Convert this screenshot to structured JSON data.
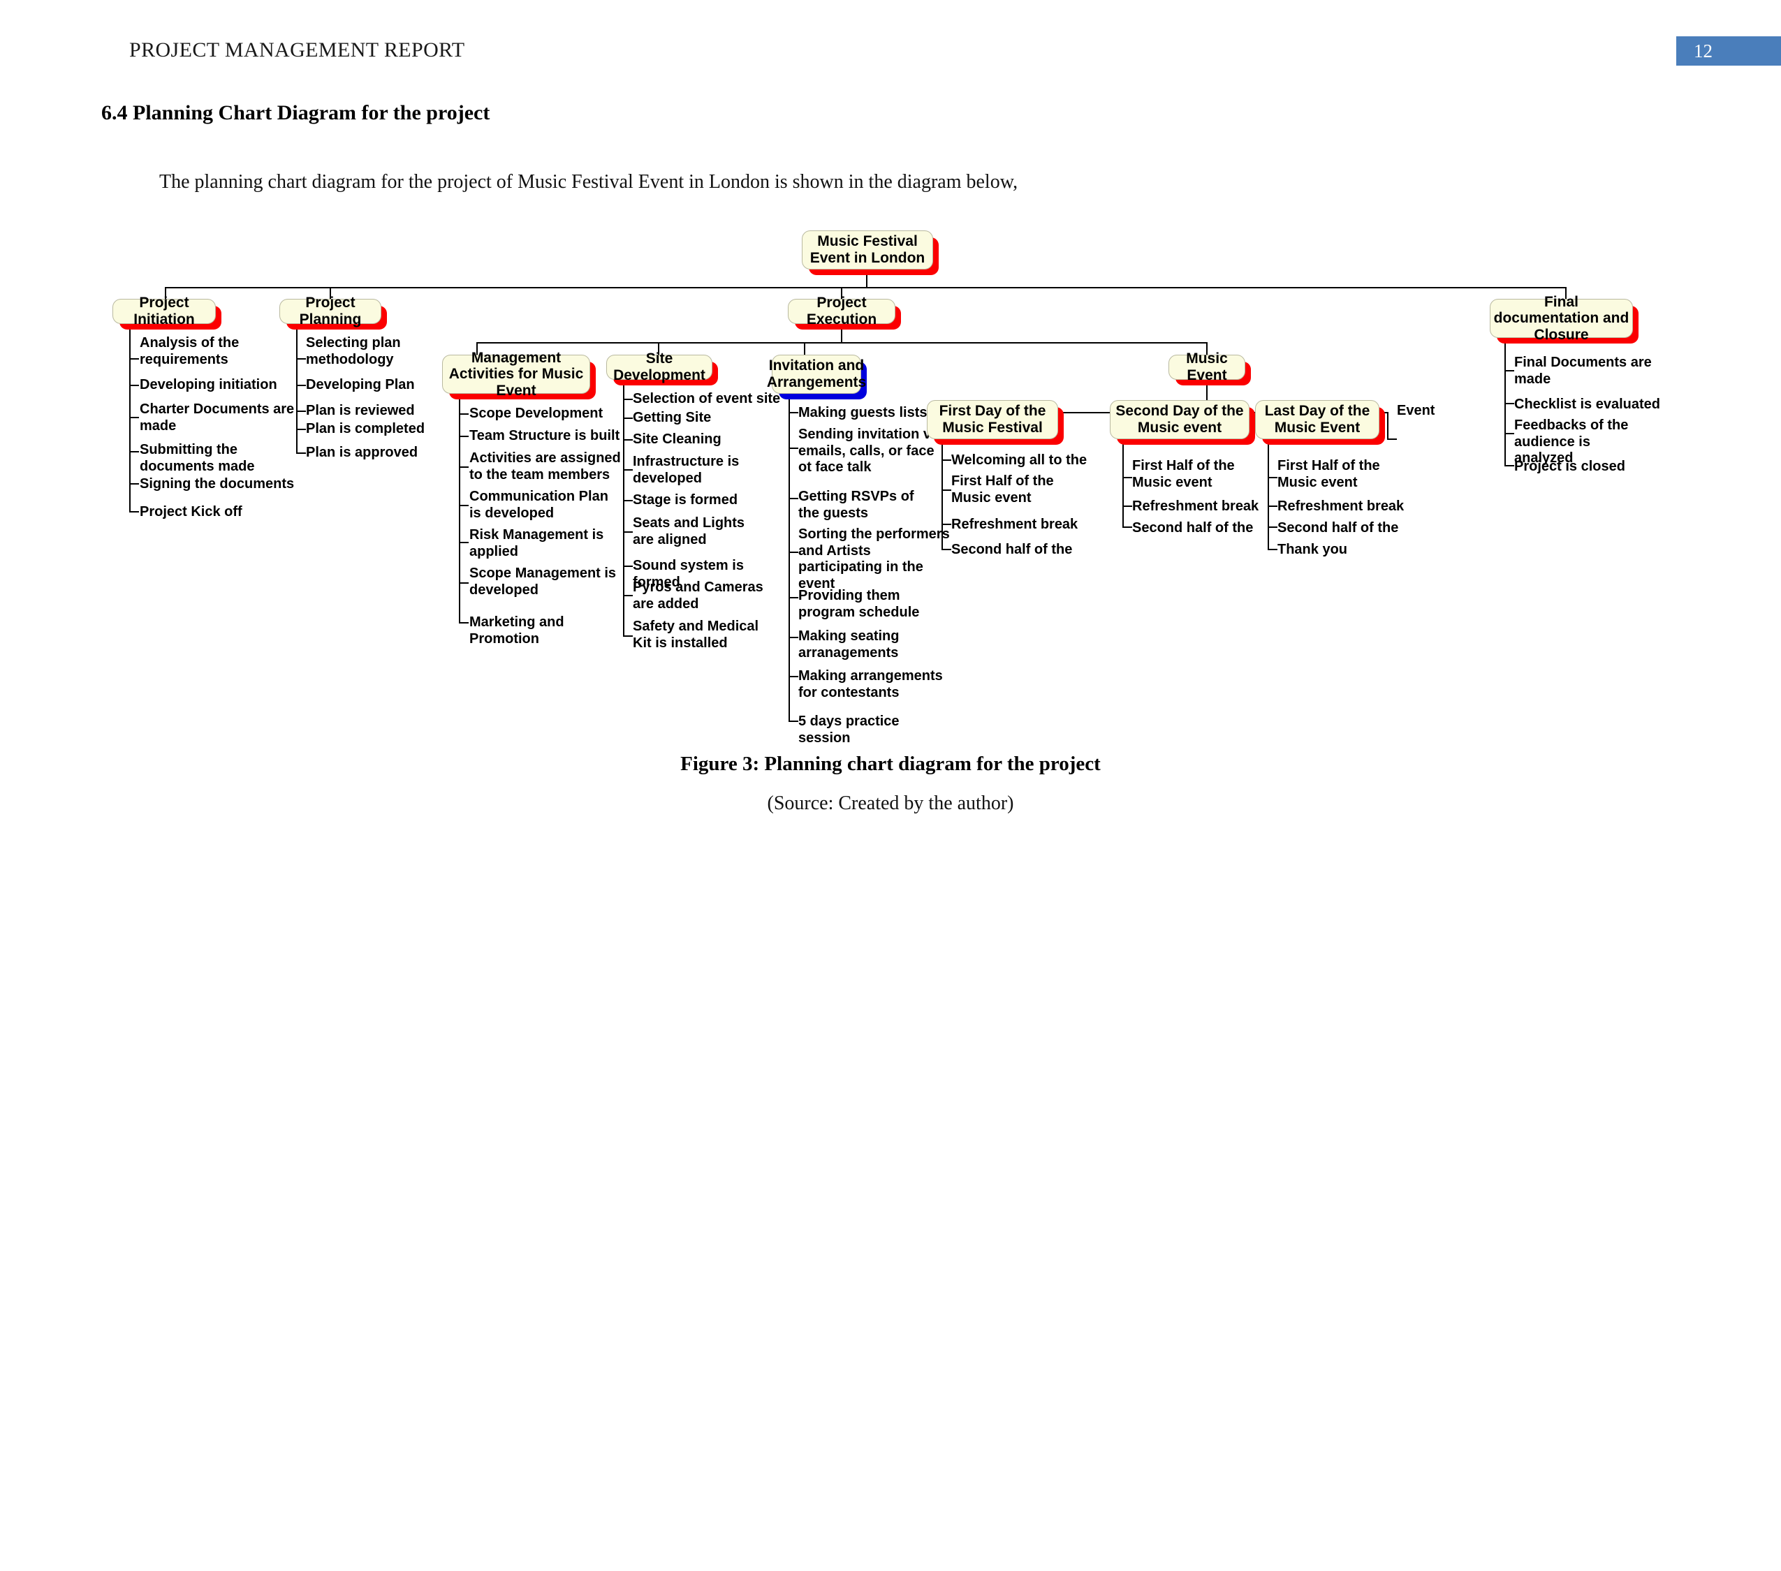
{
  "page": {
    "header_title": "PROJECT MANAGEMENT REPORT",
    "page_number": "12",
    "section_heading": "6.4 Planning Chart Diagram for the project",
    "intro_paragraph": "The planning chart diagram for the project of Music Festival Event in London is shown in the diagram below,",
    "figure_caption": "Figure 3: Planning chart diagram for the project",
    "figure_source": "(Source: Created by the author)",
    "accent_page_badge_color": "#4a7ebb",
    "node_fill_color": "#fbfbe0",
    "node_shadow_red": "#fb0000",
    "node_shadow_blue": "#0000dd"
  },
  "diagram": {
    "root": "Music Festival Event in London",
    "nodes": {
      "project_initiation": "Project Initiation",
      "project_planning": "Project Planning",
      "project_execution": "Project Execution",
      "final_documentation": "Final documentation and Closure",
      "management_activities": "Management Activities for Music Event",
      "site_development": "Site Development",
      "invitation_arrangements": "Invitation and Arrangements",
      "music_event": "Music Event",
      "first_day": "First Day of the Music Festival",
      "second_day": "Second Day of the Music event",
      "last_day": "Last Day of the Music Event",
      "event_leaf": "Event"
    },
    "leaves": {
      "project_initiation": [
        "Analysis of the requirements",
        "Developing initiation",
        "Charter Documents are made",
        "Submitting the documents made",
        "Signing the documents",
        "Project Kick off"
      ],
      "project_planning": [
        "Selecting plan methodology",
        "Developing Plan",
        "Plan is reviewed",
        "Plan is completed",
        "Plan is approved"
      ],
      "management_activities": [
        "Scope Development",
        "Team Structure is built",
        "Activities are assigned to the team members",
        "Communication Plan is developed",
        "Risk Management is applied",
        "Scope Management is developed",
        "Marketing and Promotion"
      ],
      "site_development": [
        "Selection of event site",
        "Getting Site",
        "Site Cleaning",
        "Infrastructure is developed",
        "Stage is formed",
        "Seats and Lights are aligned",
        "Sound system is formed",
        "Pyros and Cameras are added",
        "Safety and Medical Kit is installed"
      ],
      "invitation_arrangements": [
        "Making guests lists",
        "Sending invitation via emails, calls, or face ot face talk",
        "Getting RSVPs of the guests",
        "Sorting the performers and Artists participating in the event",
        "Providing them program schedule",
        "Making seating arranagements",
        "Making arrangements for contestants",
        "5 days practice session"
      ],
      "first_day": [
        "Welcoming all to the",
        "First Half of the Music event",
        "Refreshment break",
        "Second half of the"
      ],
      "second_day": [
        "First Half of the Music event",
        "Refreshment break",
        "Second half of the"
      ],
      "last_day": [
        "First Half of the Music event",
        "Refreshment break",
        "Second half of the",
        "Thank you"
      ],
      "final_documentation": [
        "Final Documents are made",
        "Checklist is evaluated",
        "Feedbacks of the audience is analyzed",
        "Project is closed"
      ]
    }
  }
}
